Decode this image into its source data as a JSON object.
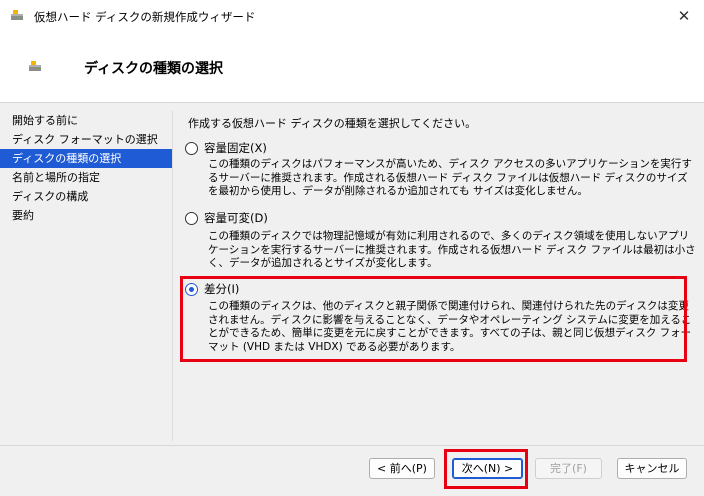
{
  "window": {
    "title": "仮想ハード ディスクの新規作成ウィザード",
    "close_glyph": "✕"
  },
  "header": {
    "title": "ディスクの種類の選択"
  },
  "nav": {
    "items": [
      {
        "label": "開始する前に",
        "active": false
      },
      {
        "label": "ディスク フォーマットの選択",
        "active": false
      },
      {
        "label": "ディスクの種類の選択",
        "active": true
      },
      {
        "label": "名前と場所の指定",
        "active": false
      },
      {
        "label": "ディスクの構成",
        "active": false
      },
      {
        "label": "要約",
        "active": false
      }
    ]
  },
  "main": {
    "intro": "作成する仮想ハード ディスクの種類を選択してください。",
    "options": [
      {
        "label": "容量固定(X)",
        "checked": false,
        "description": "この種類のディスクはパフォーマンスが高いため、ディスク アクセスの多いアプリケーションを実行するサーバーに推奨されます。作成される仮想ハード ディスク ファイルは仮想ハード ディスクのサイズを最初から使用し、データが削除されるか追加されても サイズは変化しません。"
      },
      {
        "label": "容量可変(D)",
        "checked": false,
        "description": "この種類のディスクでは物理記憶域が有効に利用されるので、多くのディスク領域を使用しないアプリケーションを実行するサーバーに推奨されます。作成される仮想ハード ディスク ファイルは最初は小さく、データが追加されるとサイズが変化します。"
      },
      {
        "label": "差分(I)",
        "checked": true,
        "description": "この種類のディスクは、他のディスクと親子関係で関連付けられ、関連付けられた先のディスクは変更されません。ディスクに影響を与えることなく、データやオペレーティング システムに変更を加えることができるため、簡単に変更を元に戻すことができます。すべての子は、親と同じ仮想ディスク フォーマット (VHD または VHDX) である必要があります。"
      }
    ]
  },
  "footer": {
    "back": "< 前へ(P)",
    "next": "次へ(N) >",
    "finish": "完了(F)",
    "cancel": "キャンセル"
  },
  "colors": {
    "accent": "#1f5bd4",
    "highlight": "#e60012"
  }
}
